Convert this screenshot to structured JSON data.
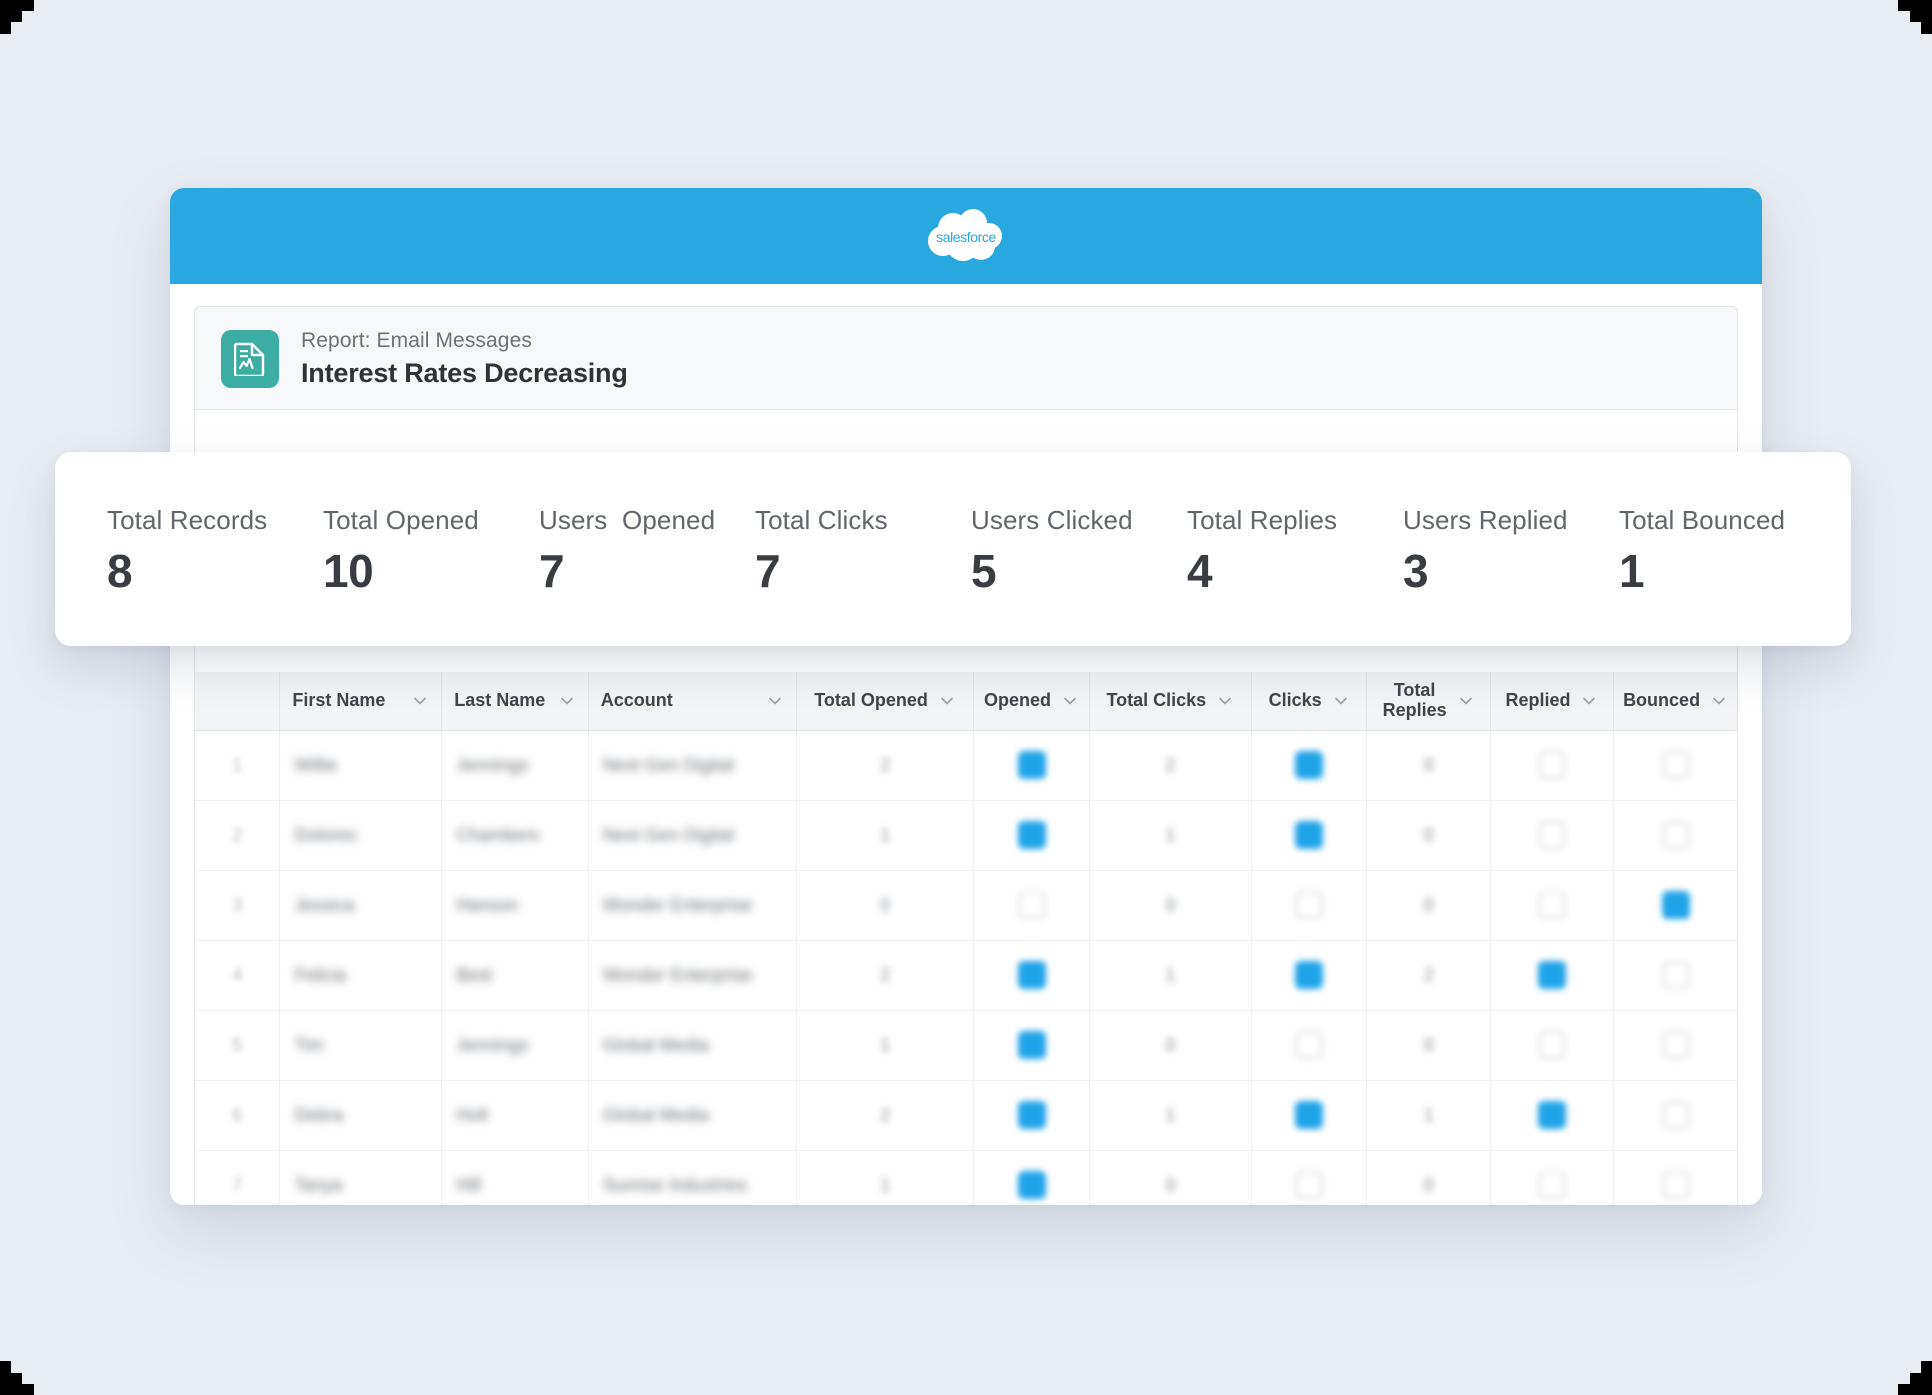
{
  "window": {
    "brand_logo": "salesforce-cloud-logo",
    "brand_name": "salesforce",
    "topbar_color": "#29a8df"
  },
  "report": {
    "icon": "report-document-chart-icon",
    "icon_color": "#3bada2",
    "kicker": "Report: Email Messages",
    "title": "Interest Rates Decreasing"
  },
  "kpis": [
    {
      "label": "Total Records",
      "value": "8"
    },
    {
      "label": "Total Opened",
      "value": "10"
    },
    {
      "label": "Users  Opened",
      "value": "7"
    },
    {
      "label": "Total Clicks",
      "value": "7"
    },
    {
      "label": "Users Clicked",
      "value": "5"
    },
    {
      "label": "Total Replies",
      "value": "4"
    },
    {
      "label": "Users Replied",
      "value": "3"
    },
    {
      "label": "Total Bounced",
      "value": "1"
    }
  ],
  "table": {
    "columns": [
      {
        "label": "First Name",
        "type": "text",
        "align": "left",
        "width": "10.5%"
      },
      {
        "label": "Last Name",
        "type": "text",
        "align": "left",
        "width": "9.5%"
      },
      {
        "label": "Account",
        "type": "text",
        "align": "left",
        "width": "13.5%"
      },
      {
        "label": "Total Opened",
        "type": "num",
        "align": "center",
        "width": "11.5%"
      },
      {
        "label": "Opened",
        "type": "chk",
        "align": "center",
        "width": "7.5%"
      },
      {
        "label": "Total Clicks",
        "type": "num",
        "align": "center",
        "width": "10.5%"
      },
      {
        "label": "Clicks",
        "type": "chk",
        "align": "center",
        "width": "7.5%"
      },
      {
        "label": "Total Replies",
        "type": "num",
        "align": "center",
        "width": "8%"
      },
      {
        "label": "Replied",
        "type": "chk",
        "align": "center",
        "width": "8%"
      },
      {
        "label": "Bounced",
        "type": "chk",
        "align": "center",
        "width": "8%"
      }
    ],
    "column_menu_icon": "chevron-down-icon",
    "rows": [
      {
        "index": "1",
        "first_name": "Willie",
        "last_name": "Jennings",
        "account": "Next Gen Digital",
        "total_opened": "2",
        "opened": true,
        "total_clicks": "2",
        "clicks": true,
        "total_replies": "0",
        "replied": false,
        "bounced": false
      },
      {
        "index": "2",
        "first_name": "Dolores",
        "last_name": "Chambers",
        "account": "Next Gen Digital",
        "total_opened": "1",
        "opened": true,
        "total_clicks": "1",
        "clicks": true,
        "total_replies": "0",
        "replied": false,
        "bounced": false
      },
      {
        "index": "3",
        "first_name": "Jessica",
        "last_name": "Hanson",
        "account": "Wonder Enterprise",
        "total_opened": "0",
        "opened": false,
        "total_clicks": "0",
        "clicks": false,
        "total_replies": "0",
        "replied": false,
        "bounced": true
      },
      {
        "index": "4",
        "first_name": "Felicia",
        "last_name": "Best",
        "account": "Wonder Enterprise",
        "total_opened": "2",
        "opened": true,
        "total_clicks": "1",
        "clicks": true,
        "total_replies": "2",
        "replied": true,
        "bounced": false
      },
      {
        "index": "5",
        "first_name": "Tim",
        "last_name": "Jennings",
        "account": "Global Media",
        "total_opened": "1",
        "opened": true,
        "total_clicks": "0",
        "clicks": false,
        "total_replies": "0",
        "replied": false,
        "bounced": false
      },
      {
        "index": "6",
        "first_name": "Debra",
        "last_name": "Holt",
        "account": "Global Media",
        "total_opened": "2",
        "opened": true,
        "total_clicks": "1",
        "clicks": true,
        "total_replies": "1",
        "replied": true,
        "bounced": false
      },
      {
        "index": "7",
        "first_name": "Tanya",
        "last_name": "Hill",
        "account": "Sunrise Industries",
        "total_opened": "1",
        "opened": true,
        "total_clicks": "0",
        "clicks": false,
        "total_replies": "0",
        "replied": false,
        "bounced": false
      }
    ]
  },
  "colors": {
    "accent_blue": "#1fa3e8",
    "topbar_blue": "#29a8df",
    "icon_teal": "#3bada2",
    "page_bg": "#e8ecf3"
  }
}
